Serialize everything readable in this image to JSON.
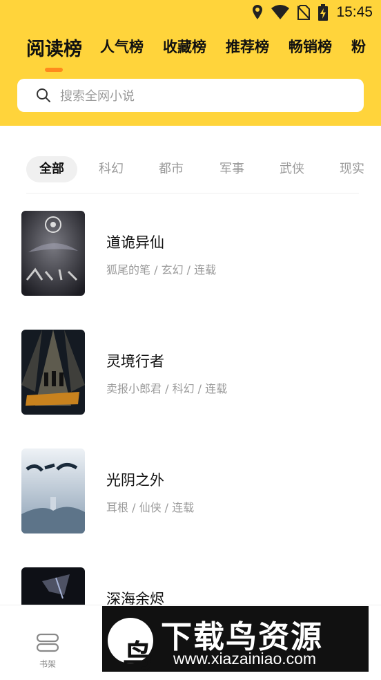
{
  "status_bar": {
    "time": "15:45"
  },
  "rank_tabs": [
    {
      "label": "阅读榜",
      "active": true
    },
    {
      "label": "人气榜"
    },
    {
      "label": "收藏榜"
    },
    {
      "label": "推荐榜"
    },
    {
      "label": "畅销榜"
    },
    {
      "label": "粉"
    }
  ],
  "search": {
    "placeholder": "搜索全网小说"
  },
  "category_tabs": [
    {
      "label": "全部",
      "active": true
    },
    {
      "label": "科幻"
    },
    {
      "label": "都市"
    },
    {
      "label": "军事"
    },
    {
      "label": "武侠"
    },
    {
      "label": "现实"
    }
  ],
  "books": [
    {
      "title": "道诡异仙",
      "meta": "狐尾的笔 / 玄幻 / 连载"
    },
    {
      "title": "灵境行者",
      "meta": "卖报小郎君 / 科幻 / 连载"
    },
    {
      "title": "光阴之外",
      "meta": "耳根 / 仙侠 / 连载"
    },
    {
      "title": "深海余烬",
      "meta": ""
    }
  ],
  "bottom_nav": {
    "bookshelf_label": "书架"
  },
  "watermark": {
    "logo_glyph": "鸟",
    "title": "下载鸟资源",
    "url": "www.xiazainiao.com"
  },
  "colors": {
    "header": "#FFD43B",
    "indicator": "#FF8A1C"
  }
}
